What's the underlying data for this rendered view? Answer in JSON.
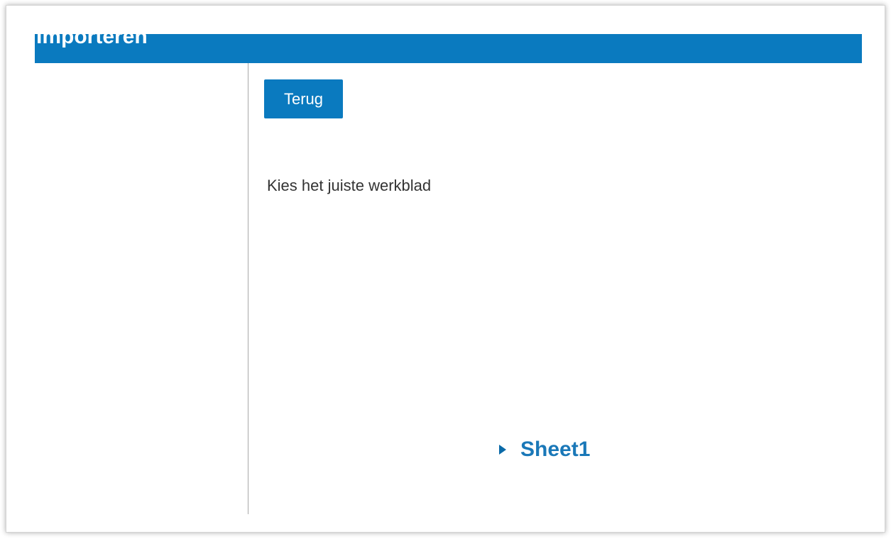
{
  "header": {
    "title": "Importeren"
  },
  "actions": {
    "back_label": "Terug"
  },
  "main": {
    "instruction": "Kies het juiste werkblad",
    "sheets": [
      {
        "label": "Sheet1",
        "icon": "caret-right-icon"
      }
    ]
  },
  "colors": {
    "accent": "#0a7abf",
    "link": "#1a78b8",
    "text": "#333333"
  }
}
